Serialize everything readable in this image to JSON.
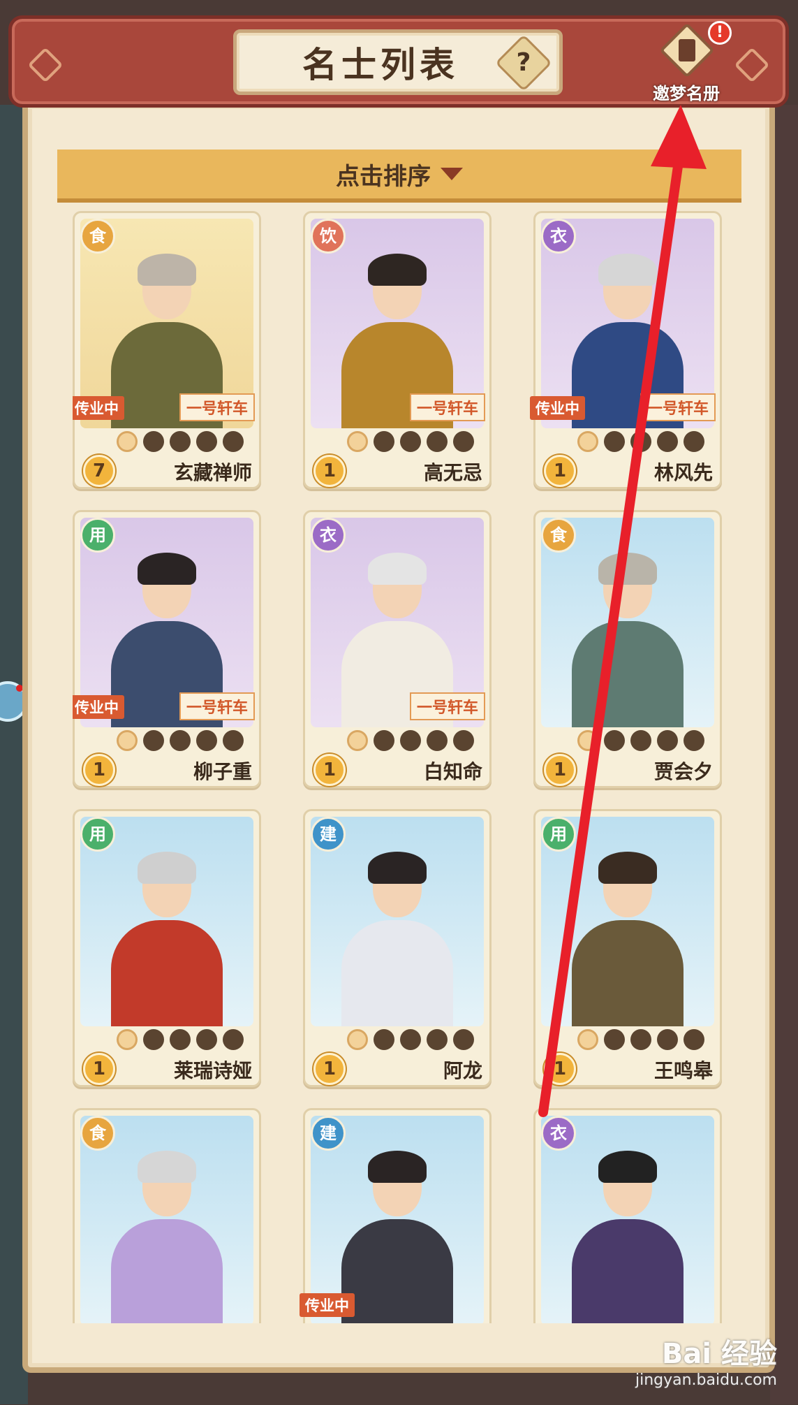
{
  "header": {
    "title": "名士列表",
    "help_label": "?",
    "dream_button_label": "邀梦名册",
    "dream_badge": "!"
  },
  "sort": {
    "label": "点击排序"
  },
  "cards": [
    {
      "name": "玄藏禅师",
      "type": "食",
      "type_color": "#e7a53f",
      "level": "7",
      "stars_on": 1,
      "cart_tag": "一号轩车",
      "teach_tag": "传业中",
      "bg": "gold",
      "hair_color": "#bdb4a8",
      "robe_color": "#6c6a3a"
    },
    {
      "name": "高无忌",
      "type": "饮",
      "type_color": "#e0735a",
      "level": "1",
      "stars_on": 1,
      "cart_tag": "一号轩车",
      "teach_tag": "",
      "bg": "purple",
      "hair_color": "#2e2622",
      "robe_color": "#b8862c"
    },
    {
      "name": "林风先",
      "type": "衣",
      "type_color": "#9b6bc6",
      "level": "1",
      "stars_on": 1,
      "cart_tag": "一号轩车",
      "teach_tag": "传业中",
      "bg": "purple",
      "hair_color": "#d6d6d6",
      "robe_color": "#2f4a84"
    },
    {
      "name": "柳子重",
      "type": "用",
      "type_color": "#4bb06b",
      "level": "1",
      "stars_on": 1,
      "cart_tag": "一号轩车",
      "teach_tag": "传业中",
      "bg": "purple",
      "hair_color": "#2a2424",
      "robe_color": "#3c4d6e"
    },
    {
      "name": "白知命",
      "type": "衣",
      "type_color": "#9b6bc6",
      "level": "1",
      "stars_on": 1,
      "cart_tag": "一号轩车",
      "teach_tag": "",
      "bg": "purple",
      "hair_color": "#e4e4e4",
      "robe_color": "#f1ece2"
    },
    {
      "name": "贾会夕",
      "type": "食",
      "type_color": "#e7a53f",
      "level": "1",
      "stars_on": 1,
      "cart_tag": "",
      "teach_tag": "",
      "bg": "blue",
      "hair_color": "#b9b4a9",
      "robe_color": "#5e7b72"
    },
    {
      "name": "莱瑞诗娅",
      "type": "用",
      "type_color": "#4bb06b",
      "level": "1",
      "stars_on": 1,
      "cart_tag": "",
      "teach_tag": "",
      "bg": "blue",
      "hair_color": "#cfcfcf",
      "robe_color": "#c23a2a"
    },
    {
      "name": "阿龙",
      "type": "建",
      "type_color": "#3f93c9",
      "level": "1",
      "stars_on": 1,
      "cart_tag": "",
      "teach_tag": "",
      "bg": "blue",
      "hair_color": "#2a2424",
      "robe_color": "#e6e8ee"
    },
    {
      "name": "王鸣皋",
      "type": "用",
      "type_color": "#4bb06b",
      "level": "1",
      "stars_on": 1,
      "cart_tag": "",
      "teach_tag": "",
      "bg": "blue",
      "hair_color": "#3a2c22",
      "robe_color": "#6a5a3a"
    },
    {
      "name": "",
      "type": "食",
      "type_color": "#e7a53f",
      "level": "",
      "stars_on": 1,
      "cart_tag": "",
      "teach_tag": "",
      "bg": "blue",
      "hair_color": "#d6d6d6",
      "robe_color": "#b9a0da"
    },
    {
      "name": "",
      "type": "建",
      "type_color": "#3f93c9",
      "level": "",
      "stars_on": 1,
      "cart_tag": "",
      "teach_tag": "传业中",
      "bg": "blue",
      "hair_color": "#2a2424",
      "robe_color": "#3a3a44"
    },
    {
      "name": "",
      "type": "衣",
      "type_color": "#9b6bc6",
      "level": "",
      "stars_on": 1,
      "cart_tag": "",
      "teach_tag": "",
      "bg": "blue",
      "hair_color": "#222222",
      "robe_color": "#4a3a6a"
    }
  ],
  "watermark": {
    "main": "Bai 经验",
    "sub": "jingyan.baidu.com"
  },
  "colors": {
    "annotation_arrow": "#e8202a"
  }
}
